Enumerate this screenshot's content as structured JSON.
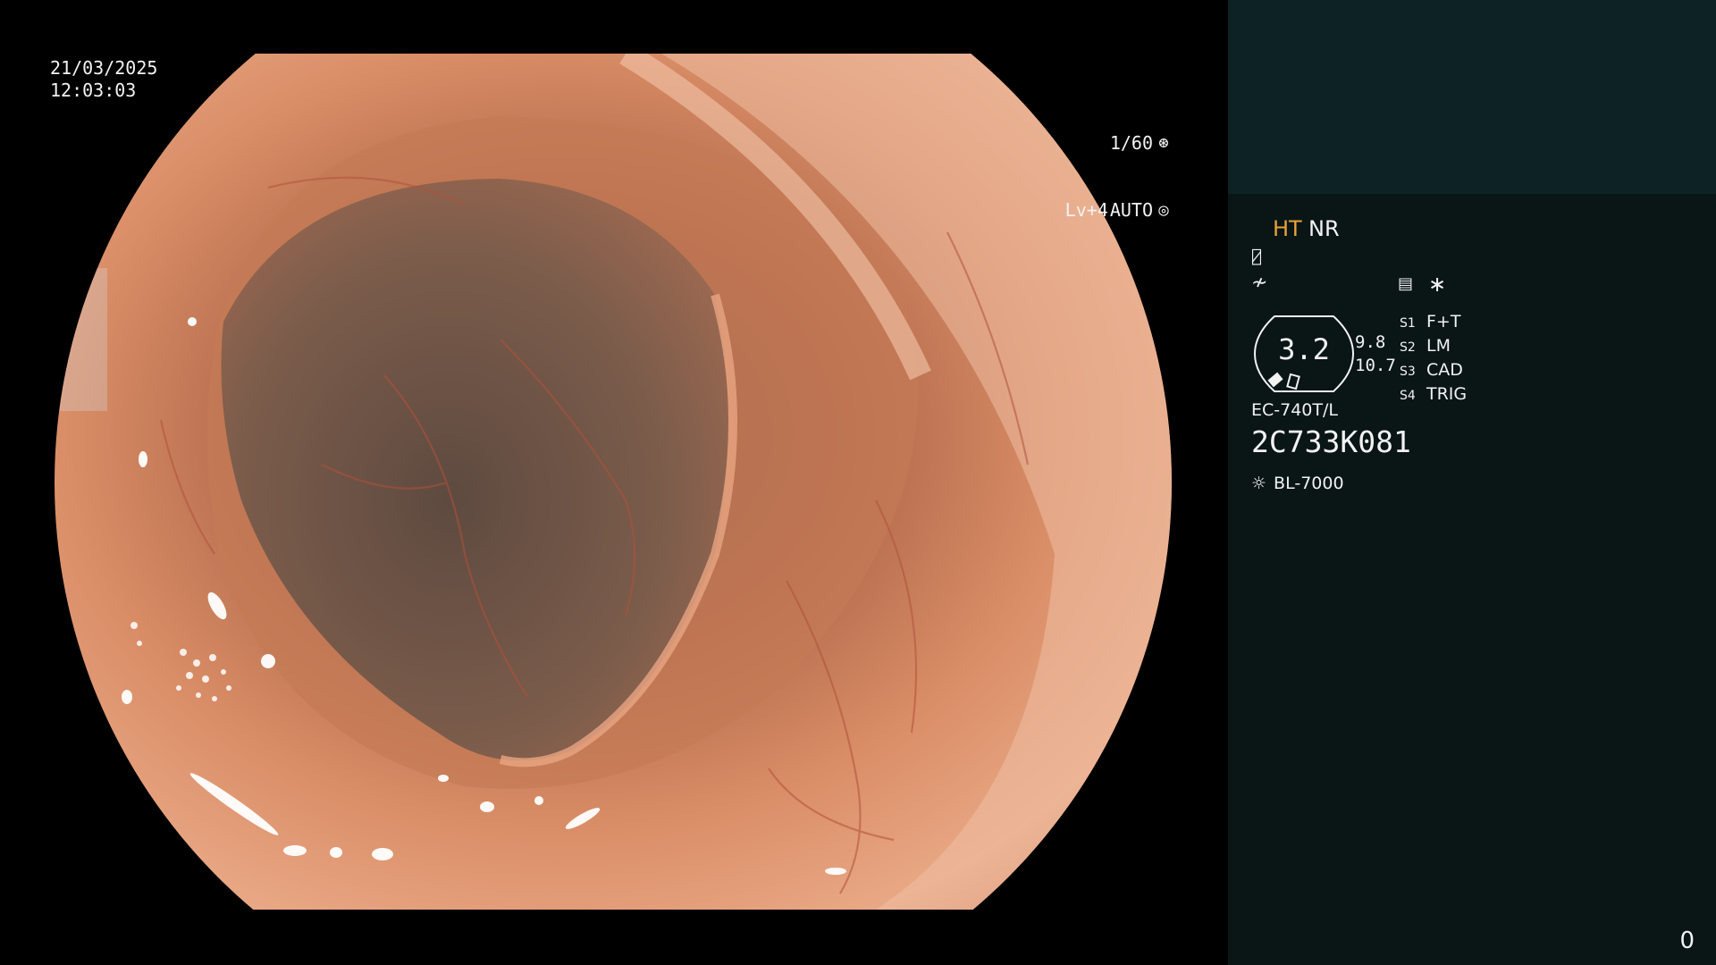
{
  "image_overlay": {
    "date": "21/03/2025",
    "time": "12:03:03",
    "shutter_speed": "1/60",
    "shutter_icon": "aperture-icon",
    "iris_level": "Lv+4",
    "iris_mode": "AUTO",
    "iris_icon": "iris-icon"
  },
  "panel": {
    "mode_ht": "HT",
    "mode_nr": "NR",
    "colors": {
      "ht": "#e8a33a",
      "panel_top": "#0d2224",
      "panel_bg": "#0a1516"
    },
    "icons": {
      "row1": "enhancement-curve-icon",
      "row2": "structure-enhance-icon",
      "settings": "settings-sheet-icon",
      "star": "asterisk-icon"
    },
    "zoom": {
      "value": "3.2",
      "aux_top": "9.8",
      "aux_bottom": "10.7"
    },
    "switches": [
      {
        "key": "S1",
        "value": "F+T"
      },
      {
        "key": "S2",
        "value": "LM"
      },
      {
        "key": "S3",
        "value": "CAD"
      },
      {
        "key": "S4",
        "value": "TRIG"
      }
    ],
    "scope_model": "EC-740T/L",
    "scope_serial": "2C733K081",
    "light_source": "BL-7000",
    "light_icon": "light-source-icon",
    "counter": "0"
  }
}
